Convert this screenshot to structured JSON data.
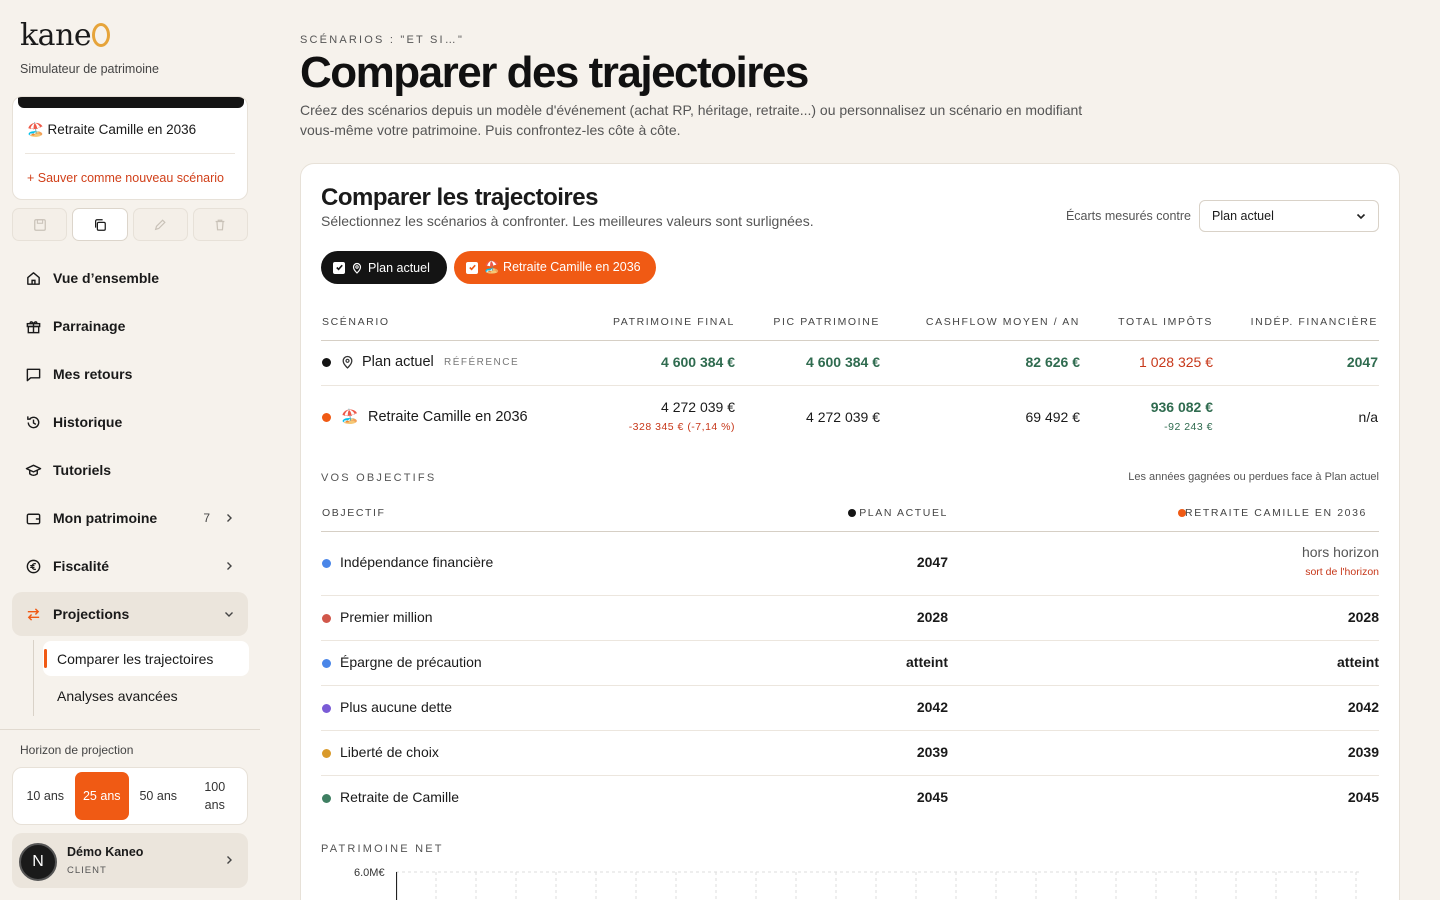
{
  "brand": {
    "logo": "kane",
    "subtitle": "Simulateur de patrimoine"
  },
  "scenario_card": {
    "item": "🏖️ Retraite Camille en 2036",
    "save_new": "+ Sauver comme nouveau scénario"
  },
  "nav": {
    "items": [
      {
        "label": "Vue d’ensemble",
        "icon": "home-icon"
      },
      {
        "label": "Parrainage",
        "icon": "gift-icon"
      },
      {
        "label": "Mes retours",
        "icon": "message-icon"
      },
      {
        "label": "Historique",
        "icon": "history-icon"
      },
      {
        "label": "Tutoriels",
        "icon": "graduation-cap-icon"
      },
      {
        "label": "Mon patrimoine",
        "icon": "wallet-icon",
        "count": "7"
      },
      {
        "label": "Fiscalité",
        "icon": "euro-icon"
      },
      {
        "label": "Projections",
        "icon": "swap-arrows-icon"
      }
    ],
    "sub_items": [
      "Comparer les trajectoires",
      "Analyses avancées"
    ]
  },
  "horizon": {
    "label": "Horizon de projection",
    "options": [
      "10 ans",
      "25 ans",
      "50 ans",
      "100 ans"
    ],
    "selected": "25 ans"
  },
  "user": {
    "avatar": "N",
    "name": "Démo Kaneo",
    "role": "CLIENT"
  },
  "page": {
    "eyebrow": "SCÉNARIOS : \"ET SI…\"",
    "title": "Comparer des trajectoires",
    "description": "Créez des scénarios depuis un modèle d'événement (achat RP, héritage, retraite...) ou personnalisez un scénario en modifiant vous-même votre patrimoine. Puis confrontez-les côte à côte."
  },
  "card": {
    "title": "Comparer les trajectoires",
    "subtitle": "Sélectionnez les scénarios à confronter. Les meilleures valeurs sont surlignées.",
    "compare_label": "Écarts mesurés contre",
    "compare_value": "Plan actuel",
    "chips": [
      "Plan actuel",
      "🏖️ Retraite Camille en 2036"
    ]
  },
  "table": {
    "headers": [
      "SCÉNARIO",
      "PATRIMOINE FINAL",
      "PIC PATRIMOINE",
      "CASHFLOW MOYEN / AN",
      "TOTAL IMPÔTS",
      "INDÉP. FINANCIÈRE"
    ],
    "rows": [
      {
        "name": "Plan actuel",
        "tag": "RÉFÉRENCE",
        "final": "4 600 384 €",
        "pic": "4 600 384 €",
        "cashflow": "82 626 €",
        "impots": "1 028 325 €",
        "indep": "2047"
      },
      {
        "name": "Retraite Camille en 2036",
        "emoji": "🏖️",
        "final": "4 272 039 €",
        "final_delta": "-328 345 € (-7,14 %)",
        "pic": "4 272 039 €",
        "cashflow": "69 492 €",
        "impots": "936 082 €",
        "impots_delta": "-92 243 €",
        "indep": "n/a"
      }
    ]
  },
  "objectives": {
    "label": "VOS OBJECTIFS",
    "note": "Les années gagnées ou perdues face à Plan actuel",
    "headers": [
      "OBJECTIF",
      "PLAN ACTUEL",
      "RETRAITE CAMILLE EN 2036"
    ],
    "rows": [
      {
        "name": "Indépendance financière",
        "a": "2047",
        "b": "hors horizon",
        "b_note": "sort de l'horizon",
        "color": "#4a86e8"
      },
      {
        "name": "Premier million",
        "a": "2028",
        "b": "2028",
        "color": "#d1574a"
      },
      {
        "name": "Épargne de précaution",
        "a": "atteint",
        "b": "atteint",
        "color": "#4a86e8"
      },
      {
        "name": "Plus aucune dette",
        "a": "2042",
        "b": "2042",
        "color": "#7a5bd6"
      },
      {
        "name": "Liberté de choix",
        "a": "2039",
        "b": "2039",
        "color": "#d99a2b"
      },
      {
        "name": "Retraite de Camille",
        "a": "2045",
        "b": "2045",
        "color": "#3f7f62"
      }
    ]
  },
  "chart": {
    "label": "PATRIMOINE NET",
    "y_max_label": "6.0M€"
  },
  "colors": {
    "accent": "#f05a14",
    "black": "#141414",
    "good": "#2f6b4f",
    "bad": "#c7381a"
  }
}
